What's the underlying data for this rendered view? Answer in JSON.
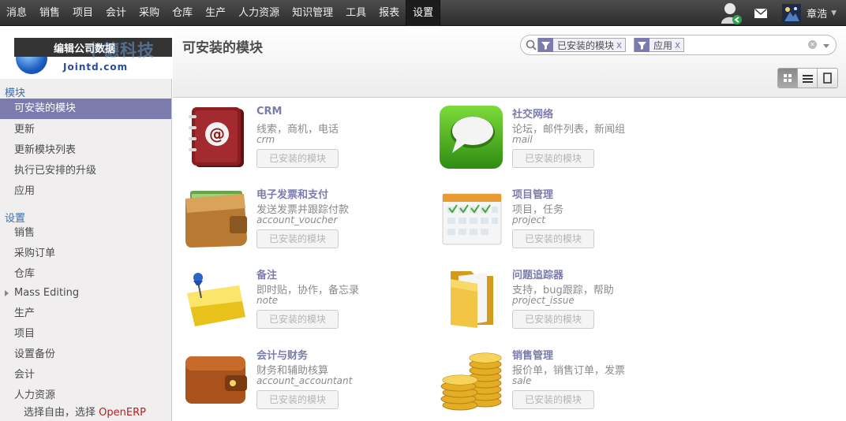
{
  "topmenu": [
    "消息",
    "销售",
    "项目",
    "会计",
    "采购",
    "仓库",
    "生产",
    "人力资源",
    "知识管理",
    "工具",
    "报表",
    "设置"
  ],
  "user": {
    "name": "章浩"
  },
  "logo": {
    "overlay": "编辑公司数据",
    "ghost": "中德科技",
    "sub": "Jointd.com"
  },
  "sidebar": {
    "section_modules": "模块",
    "modules": [
      "可安装的模块",
      "更新",
      "更新模块列表",
      "执行已安排的升级",
      "应用"
    ],
    "section_settings": "设置",
    "settings": [
      "销售",
      "采购订单",
      "仓库",
      "Mass Editing",
      "生产",
      "项目",
      "设置备份",
      "会计",
      "人力资源"
    ],
    "footer_prefix": "选择自由，选择",
    "footer_brand": "OpenERP"
  },
  "header": {
    "title": "可安装的模块"
  },
  "search": {
    "facets": [
      "已安装的模块",
      "应用"
    ],
    "remove": "x"
  },
  "cards": [
    {
      "name": "CRM",
      "summary": "线索，商机，电话",
      "technical": "crm",
      "button": "已安装的模块",
      "icon": "address-book-icon"
    },
    {
      "name": "社交网络",
      "summary": "论坛，邮件列表，新闻组",
      "technical": "mail",
      "button": "已安装的模块",
      "icon": "chat-bubble-icon"
    },
    {
      "name": "电子发票和支付",
      "summary": "发送发票并跟踪付款",
      "technical": "account_voucher",
      "button": "已安装的模块",
      "icon": "wallet-icon"
    },
    {
      "name": "项目管理",
      "summary": "项目，任务",
      "technical": "project",
      "button": "已安装的模块",
      "icon": "calendar-icon"
    },
    {
      "name": "备注",
      "summary": "即时贴，协作，备忘录",
      "technical": "note",
      "button": "已安装的模块",
      "icon": "sticky-note-icon"
    },
    {
      "name": "问题追踪器",
      "summary": "支持，bug跟踪，帮助",
      "technical": "project_issue",
      "button": "已安装的模块",
      "icon": "folder-icon"
    },
    {
      "name": "会计与财务",
      "summary": "财务和辅助核算",
      "technical": "account_accountant",
      "button": "已安装的模块",
      "icon": "brown-wallet-icon"
    },
    {
      "name": "销售管理",
      "summary": "报价单，销售订单，发票",
      "technical": "sale",
      "button": "已安装的模块",
      "icon": "coins-icon"
    }
  ]
}
